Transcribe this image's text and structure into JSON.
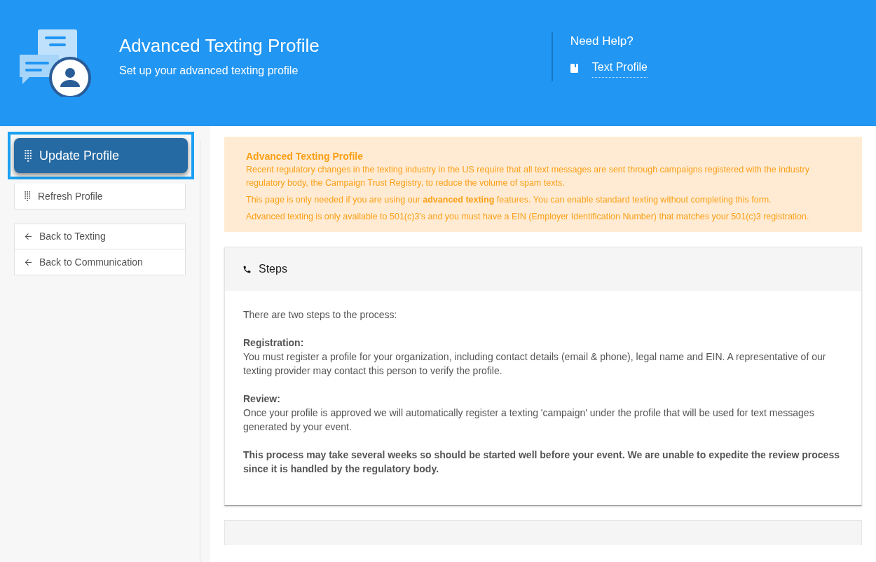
{
  "header": {
    "title": "Advanced Texting Profile",
    "subtitle": "Set up your advanced texting profile",
    "help": {
      "heading": "Need Help?",
      "link": "Text Profile"
    }
  },
  "sidebar": {
    "groups": [
      {
        "items": [
          {
            "label": "Update Profile",
            "kind": "dialpad",
            "selected": true
          },
          {
            "label": "Refresh Profile",
            "kind": "dialpad",
            "selected": false
          }
        ]
      },
      {
        "items": [
          {
            "label": "Back to Texting",
            "kind": "back",
            "selected": false
          },
          {
            "label": "Back to Communication",
            "kind": "back",
            "selected": false
          }
        ]
      }
    ]
  },
  "notice": {
    "title": "Advanced Texting Profile",
    "paragraphs": [
      "Recent regulatory changes in the texting industry in the US require that all text messages are sent through campaigns registered with the industry regulatory body, the Campaign Trust Registry, to reduce the volume of spam texts.",
      "This page is only needed if you are using our **advanced texting** features. You can enable standard texting without completing this form.",
      "Advanced texting is only available to 501(c)3's and you must have a EIN (Employer Identification Number) that matches your 501(c)3 registration."
    ]
  },
  "steps_panel": {
    "title": "Steps",
    "intro": "There are two steps to the process:",
    "steps": [
      {
        "heading": "Registration:",
        "text": "You must register a profile for your organization, including contact details (email & phone), legal name and EIN. A representative of our texting provider may contact this person to verify the profile."
      },
      {
        "heading": "Review:",
        "text": "Once your profile is approved we will automatically register a texting 'campaign' under the profile that will be used for text messages generated by your event."
      }
    ],
    "note": "This process may take several weeks so should be started well before your event. We are unable to expedite the review process since it is handled by the regulatory body."
  }
}
